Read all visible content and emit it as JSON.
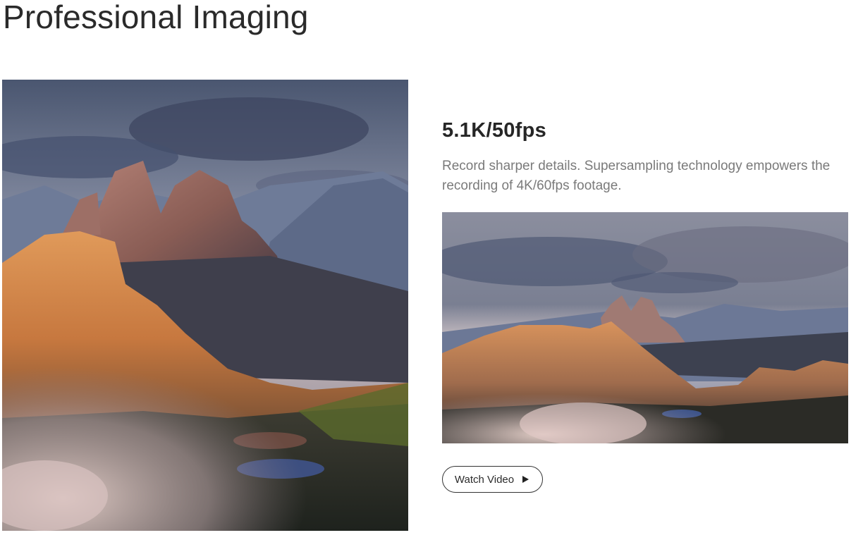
{
  "section": {
    "title": "Professional Imaging"
  },
  "feature": {
    "heading": "5.1K/50fps",
    "description": "Record sharper details. Supersampling technology empowers the recording of 4K/60fps footage."
  },
  "cta": {
    "label": "Watch Video",
    "icon": "play-icon"
  },
  "images": {
    "hero_alt": "mountain-peaks-at-sunset-vertical",
    "thumb_alt": "mountain-peaks-at-sunset-wide"
  },
  "colors": {
    "title_text": "#2a2a2a",
    "desc_text": "#7a7a7a",
    "button_border": "#333333"
  }
}
